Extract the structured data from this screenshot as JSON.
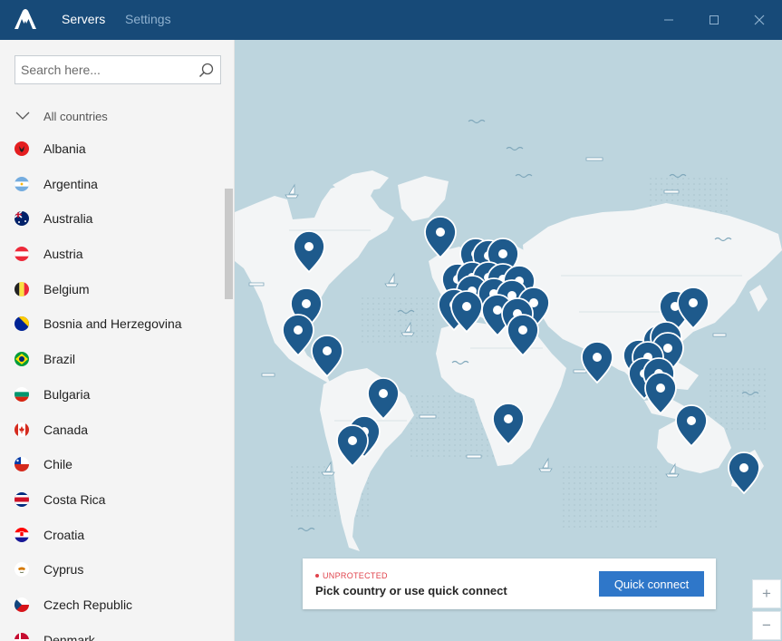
{
  "app": {
    "tabs": [
      {
        "label": "Servers",
        "active": true
      },
      {
        "label": "Settings",
        "active": false
      }
    ],
    "accent_color": "#174a78"
  },
  "sidebar": {
    "search": {
      "placeholder": "Search here...",
      "value": ""
    },
    "group_label": "All countries",
    "countries": [
      {
        "label": "Albania",
        "flag": "albania-flag"
      },
      {
        "label": "Argentina",
        "flag": "argentina-flag"
      },
      {
        "label": "Australia",
        "flag": "australia-flag"
      },
      {
        "label": "Austria",
        "flag": "austria-flag"
      },
      {
        "label": "Belgium",
        "flag": "belgium-flag"
      },
      {
        "label": "Bosnia and Herzegovina",
        "flag": "bosnia-flag"
      },
      {
        "label": "Brazil",
        "flag": "brazil-flag"
      },
      {
        "label": "Bulgaria",
        "flag": "bulgaria-flag"
      },
      {
        "label": "Canada",
        "flag": "canada-flag"
      },
      {
        "label": "Chile",
        "flag": "chile-flag"
      },
      {
        "label": "Costa Rica",
        "flag": "costa-rica-flag"
      },
      {
        "label": "Croatia",
        "flag": "croatia-flag"
      },
      {
        "label": "Cyprus",
        "flag": "cyprus-flag"
      },
      {
        "label": "Czech Republic",
        "flag": "czech-flag"
      },
      {
        "label": "Denmark",
        "flag": "denmark-flag"
      }
    ]
  },
  "status": {
    "label": "UNPROTECTED",
    "message": "Pick country or use quick connect",
    "quick_connect_label": "Quick connect",
    "color": "#e0434c"
  },
  "zoom": {
    "in_label": "+",
    "out_label": "−"
  },
  "map": {
    "pin_color": "#1e5a8c",
    "land_color": "#f3f5f6",
    "water_color": "#bdd5de"
  }
}
